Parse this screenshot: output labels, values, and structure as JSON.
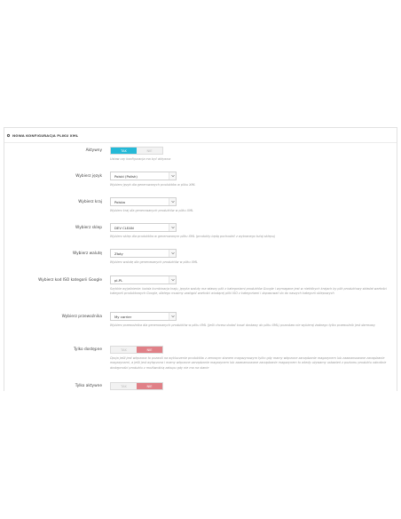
{
  "panel": {
    "title": "NOWA KONFIGURACJA PLIKU XML"
  },
  "colors": {
    "accent_yes": "#25b9d7",
    "accent_no": "#e08087"
  },
  "fields": {
    "active": {
      "label": "Aktywny",
      "yes": "TAK",
      "no": "NIE",
      "selected": "yes",
      "help": "Ustaw czy konfiguracja ma być aktywna"
    },
    "language": {
      "label": "Wybierz język",
      "value": "Polski (Polish)",
      "help": "Wybierz język dla generowanych produktów w pliku XML"
    },
    "country": {
      "label": "Wybierz kraj",
      "value": "Polska",
      "help": "Wybierz kraj dla generowanych produktów w pliku XML"
    },
    "shop": {
      "label": "Wybierz sklep",
      "value": "DEV CLEAN",
      "help": "Wybierz sklep dla produktów w generowanym pliku XML (produkty będą pochodzić z wybranego tutaj sklepu)"
    },
    "currency": {
      "label": "Wybierz walutę",
      "value": "Złoty",
      "help": "Wybierz walutę dla generowanych produktów w pliku XML"
    },
    "google_category": {
      "label": "Wybierz kod ISO kategorii Google",
      "value": "pl-PL",
      "help": "Szybkie wyjaśnienie: każda kombinacja kraju, języka waluty ma własny plik z kategoriami produktów Google i wymagane jest w niektórych krajach by plik produktowy składał wartości kategorii produktowych Google, dlatego musimy zastąpić wartości wiodącej pliki ISO z kategoriami i dopasować do do naszych kategorii sklepowych"
    },
    "carrier": {
      "label": "Wybierz przewoźnika",
      "value": "My carrier",
      "help": "Wybierz przewoźnika dla generowanych produktów w pliku XML (jeśli chcesz dodać koszt dostawy do pliku XML) pozostaw nie wybieraj żadnego tylko przewoźnik jest darmowy"
    },
    "available_only": {
      "label": "Tylko dostępne",
      "yes": "TAK",
      "no": "NIE",
      "selected": "no",
      "help": "Opcja jeśli jest włączona to pozwoli na wykluczenie produktów z zerowym stanem magazynowym tylko gdy mamy włączone zarządzanie magazynem lub zaawansowane zarządzanie magazynami, a jeśli jest wyłączona i mamy włączone zarządzanie magazynem lub zaawansowane zarządzanie magazynem to wtedy używamy ustawień z poziomu produktu odnośnie dostępności produktu z możliwością zakupu gdy nie ma na stanie"
    },
    "active_only": {
      "label": "Tylko aktywne",
      "yes": "TAK",
      "no": "NIE",
      "selected": "no"
    }
  }
}
